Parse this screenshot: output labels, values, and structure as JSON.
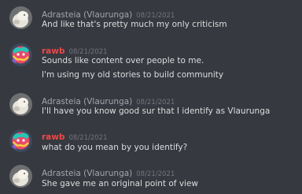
{
  "messages": [
    {
      "author": "Adrasteia (Vlaurunga)",
      "timestamp": "08/21/2021",
      "avatar": "white-cat-avatar",
      "lines": [
        "And like that's pretty much my only criticism"
      ]
    },
    {
      "author": "rawb",
      "timestamp": "08/21/2021",
      "avatar": "colorful-character-avatar",
      "lines": [
        "Sounds like content over people to me.",
        "I'm using my old stories to build community"
      ]
    },
    {
      "author": "Adrasteia (Vlaurunga)",
      "timestamp": "08/21/2021",
      "avatar": "white-cat-avatar",
      "lines": [
        "I'll have you know good sur that I identify as Vlaurunga"
      ]
    },
    {
      "author": "rawb",
      "timestamp": "08/21/2021",
      "avatar": "colorful-character-avatar",
      "lines": [
        "what do you mean by you identify?"
      ]
    },
    {
      "author": "Adrasteia (Vlaurunga)",
      "timestamp": "08/21/2021",
      "avatar": "white-cat-avatar",
      "lines": [
        "She gave me an original point of view"
      ]
    }
  ],
  "colors": {
    "background": "#36393f",
    "adrasteia_name": "#a3a6aa",
    "rawb_name": "#f04747",
    "message_text": "#dcddde",
    "timestamp": "#72767d"
  }
}
